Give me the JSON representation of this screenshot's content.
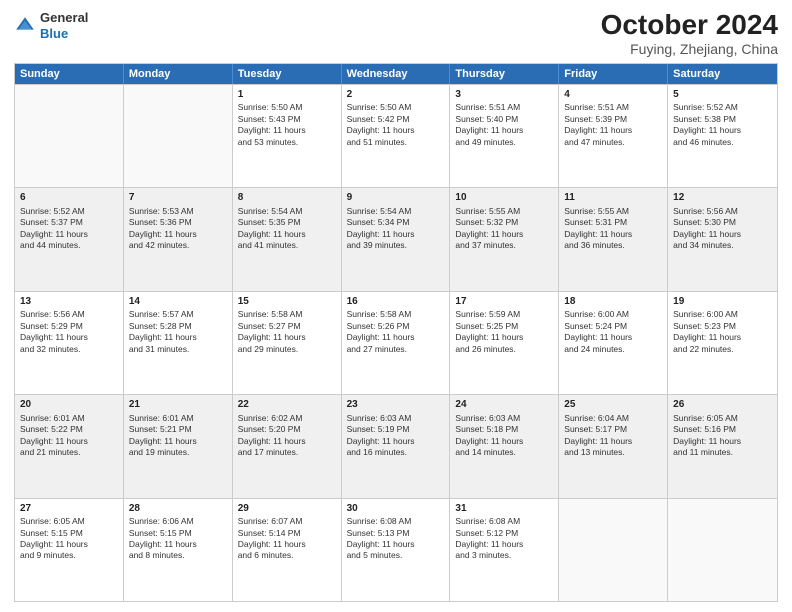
{
  "header": {
    "logo_line1": "General",
    "logo_line2": "Blue",
    "title": "October 2024",
    "subtitle": "Fuying, Zhejiang, China"
  },
  "weekdays": [
    "Sunday",
    "Monday",
    "Tuesday",
    "Wednesday",
    "Thursday",
    "Friday",
    "Saturday"
  ],
  "weeks": [
    [
      {
        "day": "",
        "sunrise": "",
        "sunset": "",
        "daylight": "",
        "empty": true
      },
      {
        "day": "",
        "sunrise": "",
        "sunset": "",
        "daylight": "",
        "empty": true
      },
      {
        "day": "1",
        "sunrise": "Sunrise: 5:50 AM",
        "sunset": "Sunset: 5:43 PM",
        "daylight": "Daylight: 11 hours and 53 minutes.",
        "empty": false
      },
      {
        "day": "2",
        "sunrise": "Sunrise: 5:50 AM",
        "sunset": "Sunset: 5:42 PM",
        "daylight": "Daylight: 11 hours and 51 minutes.",
        "empty": false
      },
      {
        "day": "3",
        "sunrise": "Sunrise: 5:51 AM",
        "sunset": "Sunset: 5:40 PM",
        "daylight": "Daylight: 11 hours and 49 minutes.",
        "empty": false
      },
      {
        "day": "4",
        "sunrise": "Sunrise: 5:51 AM",
        "sunset": "Sunset: 5:39 PM",
        "daylight": "Daylight: 11 hours and 47 minutes.",
        "empty": false
      },
      {
        "day": "5",
        "sunrise": "Sunrise: 5:52 AM",
        "sunset": "Sunset: 5:38 PM",
        "daylight": "Daylight: 11 hours and 46 minutes.",
        "empty": false
      }
    ],
    [
      {
        "day": "6",
        "sunrise": "Sunrise: 5:52 AM",
        "sunset": "Sunset: 5:37 PM",
        "daylight": "Daylight: 11 hours and 44 minutes.",
        "empty": false
      },
      {
        "day": "7",
        "sunrise": "Sunrise: 5:53 AM",
        "sunset": "Sunset: 5:36 PM",
        "daylight": "Daylight: 11 hours and 42 minutes.",
        "empty": false
      },
      {
        "day": "8",
        "sunrise": "Sunrise: 5:54 AM",
        "sunset": "Sunset: 5:35 PM",
        "daylight": "Daylight: 11 hours and 41 minutes.",
        "empty": false
      },
      {
        "day": "9",
        "sunrise": "Sunrise: 5:54 AM",
        "sunset": "Sunset: 5:34 PM",
        "daylight": "Daylight: 11 hours and 39 minutes.",
        "empty": false
      },
      {
        "day": "10",
        "sunrise": "Sunrise: 5:55 AM",
        "sunset": "Sunset: 5:32 PM",
        "daylight": "Daylight: 11 hours and 37 minutes.",
        "empty": false
      },
      {
        "day": "11",
        "sunrise": "Sunrise: 5:55 AM",
        "sunset": "Sunset: 5:31 PM",
        "daylight": "Daylight: 11 hours and 36 minutes.",
        "empty": false
      },
      {
        "day": "12",
        "sunrise": "Sunrise: 5:56 AM",
        "sunset": "Sunset: 5:30 PM",
        "daylight": "Daylight: 11 hours and 34 minutes.",
        "empty": false
      }
    ],
    [
      {
        "day": "13",
        "sunrise": "Sunrise: 5:56 AM",
        "sunset": "Sunset: 5:29 PM",
        "daylight": "Daylight: 11 hours and 32 minutes.",
        "empty": false
      },
      {
        "day": "14",
        "sunrise": "Sunrise: 5:57 AM",
        "sunset": "Sunset: 5:28 PM",
        "daylight": "Daylight: 11 hours and 31 minutes.",
        "empty": false
      },
      {
        "day": "15",
        "sunrise": "Sunrise: 5:58 AM",
        "sunset": "Sunset: 5:27 PM",
        "daylight": "Daylight: 11 hours and 29 minutes.",
        "empty": false
      },
      {
        "day": "16",
        "sunrise": "Sunrise: 5:58 AM",
        "sunset": "Sunset: 5:26 PM",
        "daylight": "Daylight: 11 hours and 27 minutes.",
        "empty": false
      },
      {
        "day": "17",
        "sunrise": "Sunrise: 5:59 AM",
        "sunset": "Sunset: 5:25 PM",
        "daylight": "Daylight: 11 hours and 26 minutes.",
        "empty": false
      },
      {
        "day": "18",
        "sunrise": "Sunrise: 6:00 AM",
        "sunset": "Sunset: 5:24 PM",
        "daylight": "Daylight: 11 hours and 24 minutes.",
        "empty": false
      },
      {
        "day": "19",
        "sunrise": "Sunrise: 6:00 AM",
        "sunset": "Sunset: 5:23 PM",
        "daylight": "Daylight: 11 hours and 22 minutes.",
        "empty": false
      }
    ],
    [
      {
        "day": "20",
        "sunrise": "Sunrise: 6:01 AM",
        "sunset": "Sunset: 5:22 PM",
        "daylight": "Daylight: 11 hours and 21 minutes.",
        "empty": false
      },
      {
        "day": "21",
        "sunrise": "Sunrise: 6:01 AM",
        "sunset": "Sunset: 5:21 PM",
        "daylight": "Daylight: 11 hours and 19 minutes.",
        "empty": false
      },
      {
        "day": "22",
        "sunrise": "Sunrise: 6:02 AM",
        "sunset": "Sunset: 5:20 PM",
        "daylight": "Daylight: 11 hours and 17 minutes.",
        "empty": false
      },
      {
        "day": "23",
        "sunrise": "Sunrise: 6:03 AM",
        "sunset": "Sunset: 5:19 PM",
        "daylight": "Daylight: 11 hours and 16 minutes.",
        "empty": false
      },
      {
        "day": "24",
        "sunrise": "Sunrise: 6:03 AM",
        "sunset": "Sunset: 5:18 PM",
        "daylight": "Daylight: 11 hours and 14 minutes.",
        "empty": false
      },
      {
        "day": "25",
        "sunrise": "Sunrise: 6:04 AM",
        "sunset": "Sunset: 5:17 PM",
        "daylight": "Daylight: 11 hours and 13 minutes.",
        "empty": false
      },
      {
        "day": "26",
        "sunrise": "Sunrise: 6:05 AM",
        "sunset": "Sunset: 5:16 PM",
        "daylight": "Daylight: 11 hours and 11 minutes.",
        "empty": false
      }
    ],
    [
      {
        "day": "27",
        "sunrise": "Sunrise: 6:05 AM",
        "sunset": "Sunset: 5:15 PM",
        "daylight": "Daylight: 11 hours and 9 minutes.",
        "empty": false
      },
      {
        "day": "28",
        "sunrise": "Sunrise: 6:06 AM",
        "sunset": "Sunset: 5:15 PM",
        "daylight": "Daylight: 11 hours and 8 minutes.",
        "empty": false
      },
      {
        "day": "29",
        "sunrise": "Sunrise: 6:07 AM",
        "sunset": "Sunset: 5:14 PM",
        "daylight": "Daylight: 11 hours and 6 minutes.",
        "empty": false
      },
      {
        "day": "30",
        "sunrise": "Sunrise: 6:08 AM",
        "sunset": "Sunset: 5:13 PM",
        "daylight": "Daylight: 11 hours and 5 minutes.",
        "empty": false
      },
      {
        "day": "31",
        "sunrise": "Sunrise: 6:08 AM",
        "sunset": "Sunset: 5:12 PM",
        "daylight": "Daylight: 11 hours and 3 minutes.",
        "empty": false
      },
      {
        "day": "",
        "sunrise": "",
        "sunset": "",
        "daylight": "",
        "empty": true
      },
      {
        "day": "",
        "sunrise": "",
        "sunset": "",
        "daylight": "",
        "empty": true
      }
    ]
  ]
}
